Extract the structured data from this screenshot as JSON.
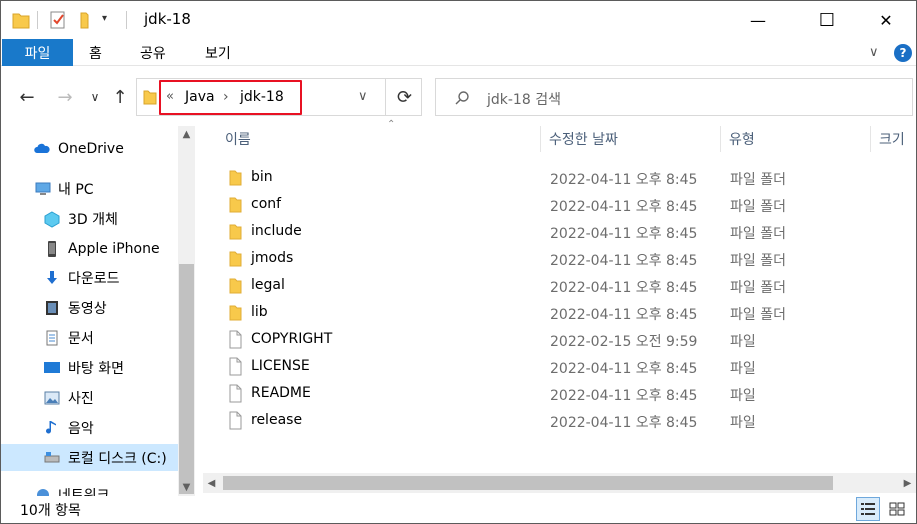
{
  "window": {
    "title": "jdk-18",
    "controls": {
      "minimize": "—",
      "maximize": "☐",
      "close": "✕"
    }
  },
  "ribbon": {
    "tabs": [
      "파일",
      "홈",
      "공유",
      "보기"
    ],
    "expand_glyph": "∨",
    "help_glyph": "?"
  },
  "nav": {
    "back_glyph": "←",
    "forward_glyph": "→",
    "recent_glyph": "∨",
    "up_glyph": "↑",
    "breadcrumb_overflow": "«",
    "breadcrumb": [
      "Java",
      "jdk-18"
    ],
    "separator_glyph": "›",
    "dropdown_glyph": "∨",
    "refresh_glyph": "⟳",
    "search_placeholder": "jdk-18 검색"
  },
  "sidebar": {
    "items": [
      {
        "label": "OneDrive",
        "icon": "cloud-icon",
        "level": 0
      },
      {
        "label": "내 PC",
        "icon": "pc-icon",
        "level": 0
      },
      {
        "label": "3D 개체",
        "icon": "cube-icon",
        "level": 1
      },
      {
        "label": "Apple iPhone",
        "icon": "phone-icon",
        "level": 1
      },
      {
        "label": "다운로드",
        "icon": "download-icon",
        "level": 1
      },
      {
        "label": "동영상",
        "icon": "video-icon",
        "level": 1
      },
      {
        "label": "문서",
        "icon": "document-icon",
        "level": 1
      },
      {
        "label": "바탕 화면",
        "icon": "desktop-icon",
        "level": 1
      },
      {
        "label": "사진",
        "icon": "picture-icon",
        "level": 1
      },
      {
        "label": "음악",
        "icon": "music-icon",
        "level": 1
      },
      {
        "label": "로컬 디스크 (C:)",
        "icon": "drive-icon",
        "level": 1,
        "selected": true
      },
      {
        "label": "네트워크",
        "icon": "network-icon",
        "level": 0
      }
    ]
  },
  "columns": {
    "name": "이름",
    "date": "수정한 날짜",
    "type": "유형",
    "size": "크기"
  },
  "files": [
    {
      "name": "bin",
      "date": "2022-04-11 오후 8:45",
      "type": "파일 폴더",
      "kind": "folder"
    },
    {
      "name": "conf",
      "date": "2022-04-11 오후 8:45",
      "type": "파일 폴더",
      "kind": "folder"
    },
    {
      "name": "include",
      "date": "2022-04-11 오후 8:45",
      "type": "파일 폴더",
      "kind": "folder"
    },
    {
      "name": "jmods",
      "date": "2022-04-11 오후 8:45",
      "type": "파일 폴더",
      "kind": "folder"
    },
    {
      "name": "legal",
      "date": "2022-04-11 오후 8:45",
      "type": "파일 폴더",
      "kind": "folder"
    },
    {
      "name": "lib",
      "date": "2022-04-11 오후 8:45",
      "type": "파일 폴더",
      "kind": "folder"
    },
    {
      "name": "COPYRIGHT",
      "date": "2022-02-15 오전 9:59",
      "type": "파일",
      "kind": "file"
    },
    {
      "name": "LICENSE",
      "date": "2022-04-11 오후 8:45",
      "type": "파일",
      "kind": "file"
    },
    {
      "name": "README",
      "date": "2022-04-11 오후 8:45",
      "type": "파일",
      "kind": "file"
    },
    {
      "name": "release",
      "date": "2022-04-11 오후 8:45",
      "type": "파일",
      "kind": "file"
    }
  ],
  "status": {
    "item_count": "10개 항목"
  },
  "colors": {
    "accent": "#1979ca",
    "selection": "#cce8ff",
    "highlight_border": "#e81123",
    "folder": "#f8c94b"
  }
}
